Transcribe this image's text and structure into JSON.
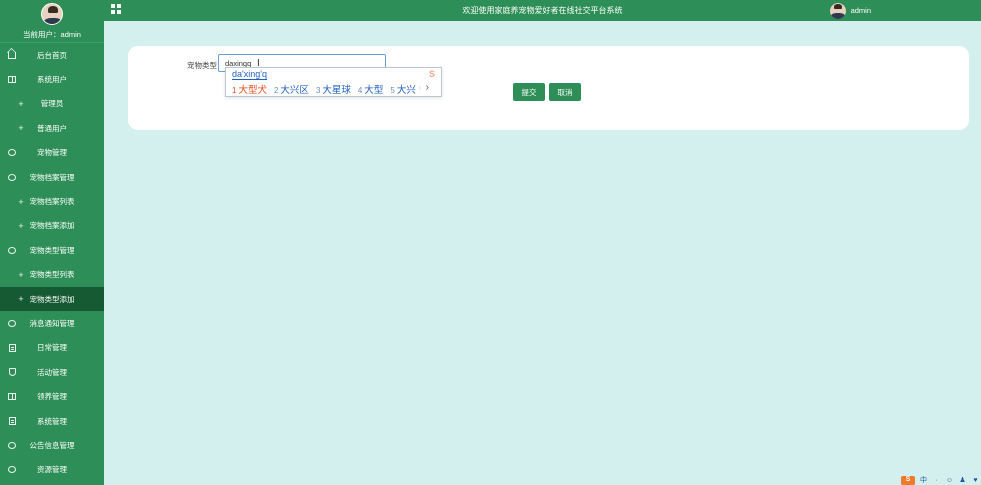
{
  "sidebar": {
    "current_user": "当前用户：admin",
    "items": [
      {
        "label": "后台首页",
        "icon": "home-icon"
      },
      {
        "label": "系统用户",
        "icon": "book-icon"
      },
      {
        "label": "管理员",
        "icon": "plus-icon"
      },
      {
        "label": "普通用户",
        "icon": "plus-icon"
      },
      {
        "label": "宠物管理",
        "icon": "chat-icon"
      },
      {
        "label": "宠物档案管理",
        "icon": "chat-icon"
      },
      {
        "label": "宠物档案列表",
        "icon": "plus-icon"
      },
      {
        "label": "宠物档案添加",
        "icon": "plus-icon"
      },
      {
        "label": "宠物类型管理",
        "icon": "chat-icon"
      },
      {
        "label": "宠物类型列表",
        "icon": "plus-icon"
      },
      {
        "label": "宠物类型添加",
        "icon": "plus-icon"
      },
      {
        "label": "消息通知管理",
        "icon": "chat-icon"
      },
      {
        "label": "日常管理",
        "icon": "document-icon"
      },
      {
        "label": "活动管理",
        "icon": "shield-icon"
      },
      {
        "label": "领养管理",
        "icon": "book-icon"
      },
      {
        "label": "系统管理",
        "icon": "document-icon"
      },
      {
        "label": "公告信息管理",
        "icon": "chat-icon"
      },
      {
        "label": "资源管理",
        "icon": "chat-icon"
      }
    ]
  },
  "topbar": {
    "title": "欢迎使用家庭养宠物爱好者在线社交平台系统",
    "username": "admin"
  },
  "form": {
    "label": "宠物类型",
    "value": "daxingq",
    "submit_label": "提交",
    "cancel_label": "取消"
  },
  "ime": {
    "composition": "da'xing'q",
    "candidates": [
      {
        "n": "1",
        "text": "大型犬"
      },
      {
        "n": "2",
        "text": "大兴区"
      },
      {
        "n": "3",
        "text": "大星球"
      },
      {
        "n": "4",
        "text": "大型"
      },
      {
        "n": "5",
        "text": "大兴"
      }
    ],
    "more": "›",
    "logo": "S"
  },
  "tray": {
    "ime_label": "S",
    "lang_label": "中"
  },
  "colors": {
    "primary": "#2d8f57",
    "active": "#165a33",
    "background": "#d4f0ee"
  }
}
